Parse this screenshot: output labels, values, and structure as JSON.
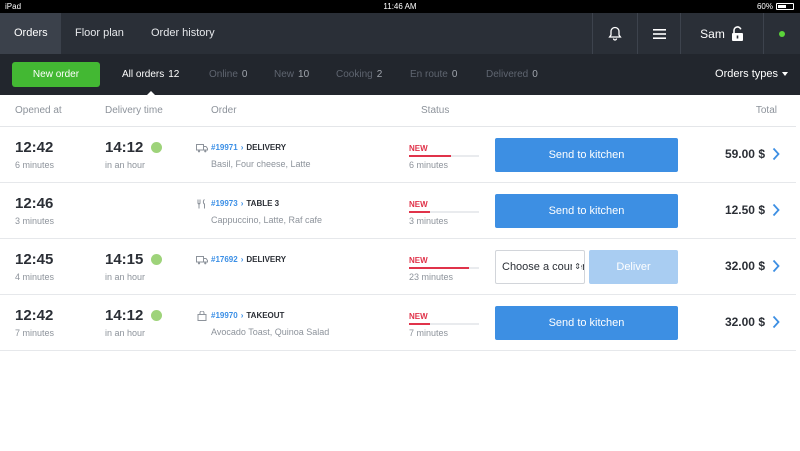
{
  "statusbar": {
    "device": "iPad",
    "time": "11:46 AM",
    "battery": "60%"
  },
  "nav": {
    "tabs": [
      {
        "label": "Orders",
        "active": true
      },
      {
        "label": "Floor plan",
        "active": false
      },
      {
        "label": "Order history",
        "active": false
      }
    ],
    "user": "Sam",
    "icons": [
      "bell-icon",
      "menu-icon",
      "unlock-icon",
      "online-status-dot"
    ]
  },
  "filters": {
    "new_order": "New order",
    "items": [
      {
        "label": "All orders",
        "count": "12",
        "active": true
      },
      {
        "label": "Online",
        "count": "0",
        "active": false
      },
      {
        "label": "New",
        "count": "10",
        "active": false
      },
      {
        "label": "Cooking",
        "count": "2",
        "active": false
      },
      {
        "label": "En route",
        "count": "0",
        "active": false
      },
      {
        "label": "Delivered",
        "count": "0",
        "active": false
      }
    ],
    "orders_types": "Orders types"
  },
  "columns": {
    "opened_at": "Opened at",
    "delivery_time": "Delivery time",
    "order": "Order",
    "status": "Status",
    "total": "Total"
  },
  "orders": [
    {
      "opened_time": "12:42",
      "opened_ago": "6 minutes",
      "delivery_time": "14:12",
      "delivery_in": "in an hour",
      "type_icon": "delivery-truck-icon",
      "number": "#19971",
      "arrow": "›",
      "type": "DELIVERY",
      "items": "Basil, Four cheese, Latte",
      "status": "NEW",
      "status_progress": 0.6,
      "status_time": "6 minutes",
      "action": "Send to kitchen",
      "total": "59.00 $"
    },
    {
      "opened_time": "12:46",
      "opened_ago": "3 minutes",
      "delivery_time": "",
      "delivery_in": "",
      "type_icon": "cutlery-icon",
      "number": "#19973",
      "arrow": "›",
      "type": "TABLE 3",
      "items": "Cappuccino, Latte, Raf cafe",
      "status": "NEW",
      "status_progress": 0.3,
      "status_time": "3 minutes",
      "action": "Send to kitchen",
      "total": "12.50 $"
    },
    {
      "opened_time": "12:45",
      "opened_ago": "4 minutes",
      "delivery_time": "14:15",
      "delivery_in": "in an hour",
      "type_icon": "delivery-truck-icon",
      "number": "#17692",
      "arrow": "›",
      "type": "DELIVERY",
      "items": "",
      "status": "NEW",
      "status_progress": 0.85,
      "status_time": "23 minutes",
      "courier_select": "Choose a courier",
      "deliver": "Deliver",
      "total": "32.00 $"
    },
    {
      "opened_time": "12:42",
      "opened_ago": "7 minutes",
      "delivery_time": "14:12",
      "delivery_in": "in an hour",
      "type_icon": "takeout-bag-icon",
      "number": "#19970",
      "arrow": "›",
      "type": "TAKEOUT",
      "items": "Avocado Toast, Quinoa Salad",
      "status": "NEW",
      "status_progress": 0.3,
      "status_time": "7 minutes",
      "action": "Send to kitchen",
      "total": "32.00 $"
    }
  ],
  "colors": {
    "nav_bg": "#2a2f37",
    "filter_bg": "#22262d",
    "accent_green": "#43b833",
    "accent_blue": "#3d8fe3",
    "status_red": "#e0334a"
  }
}
